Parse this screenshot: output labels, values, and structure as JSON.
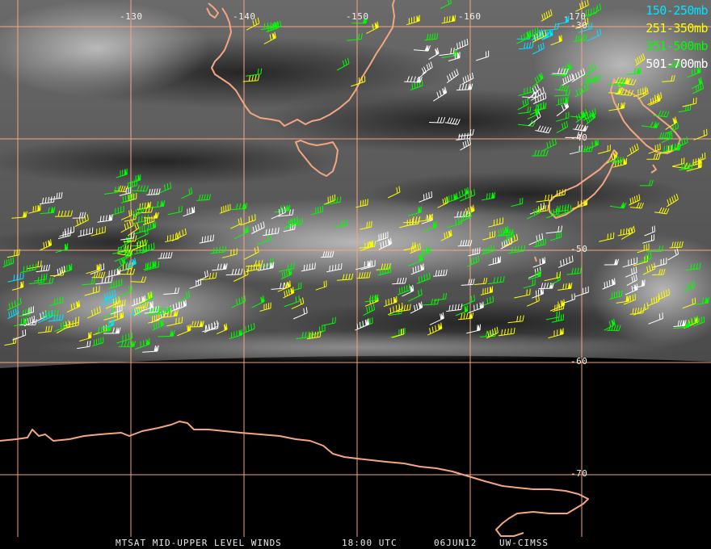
{
  "map": {
    "longitude_labels": [
      "-130",
      "-140",
      "-150",
      "-160",
      "-170"
    ],
    "latitude_labels": [
      "-30",
      "-40",
      "-50",
      "-60",
      "-70"
    ]
  },
  "legend": [
    {
      "label": "150-250mb",
      "color": "#00e5ff"
    },
    {
      "label": "251-350mb",
      "color": "#ffff00"
    },
    {
      "label": "351-500mb",
      "color": "#00ff00"
    },
    {
      "label": "501-700mb",
      "color": "#ffffff"
    }
  ],
  "footer": {
    "product": "MTSAT MID-UPPER LEVEL WINDS",
    "time": "18:00 UTC",
    "date": "06JUN12",
    "credit": "UW-CIMSS"
  },
  "colors": {
    "coastline": "#f4a582",
    "grid": "#f4a582",
    "background": "#000000"
  }
}
